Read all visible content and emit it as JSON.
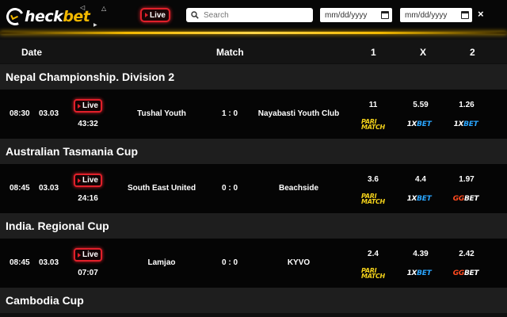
{
  "header": {
    "logo": {
      "part1": "C",
      "part2": "heck",
      "part3": "bet"
    },
    "live_label": "Live",
    "search": {
      "placeholder": "Search",
      "value": ""
    },
    "date_from": {
      "placeholder": "mm/dd/yyyy"
    },
    "date_to": {
      "placeholder": "mm/dd/yyyy"
    },
    "close_label": "×"
  },
  "columns": {
    "date": "Date",
    "match": "Match",
    "one": "1",
    "x": "X",
    "two": "2"
  },
  "sections": [
    {
      "league": "Nepal Championship. Division 2",
      "match": {
        "time": "08:30",
        "date": "03.03",
        "live": "Live",
        "clock": "43:32",
        "home": "Tushal Youth",
        "score": "1 : 0",
        "away": "Nayabasti Youth Club",
        "odds": [
          "11",
          "5.59",
          "1.26"
        ],
        "bookmakers": [
          "parimatch",
          "1xbet",
          "1xbet"
        ]
      }
    },
    {
      "league": "Australian Tasmania Cup",
      "match": {
        "time": "08:45",
        "date": "03.03",
        "live": "Live",
        "clock": "24:16",
        "home": "South East United",
        "score": "0 : 0",
        "away": "Beachside",
        "odds": [
          "3.6",
          "4.4",
          "1.97"
        ],
        "bookmakers": [
          "parimatch",
          "1xbet",
          "ggbet"
        ]
      }
    },
    {
      "league": "India. Regional Cup",
      "match": {
        "time": "08:45",
        "date": "03.03",
        "live": "Live",
        "clock": "07:07",
        "home": "Lamjao",
        "score": "0 : 0",
        "away": "KYVO",
        "odds": [
          "2.4",
          "4.39",
          "2.42"
        ],
        "bookmakers": [
          "parimatch",
          "1xbet",
          "ggbet"
        ]
      }
    },
    {
      "league": "Cambodia Cup"
    }
  ],
  "bookmaker_labels": {
    "parimatch": {
      "line1": "PARI",
      "line2": "MATCH"
    },
    "1xbet": {
      "a": "1X",
      "b": "BET"
    },
    "ggbet": {
      "a": "GG",
      "b": "BET"
    }
  },
  "colors": {
    "accent": "#f2b800",
    "live": "#e0202a",
    "parimatch": "#f4d21a",
    "onexbet": "#2aa6ff",
    "ggbet": "#ff4a1f"
  }
}
